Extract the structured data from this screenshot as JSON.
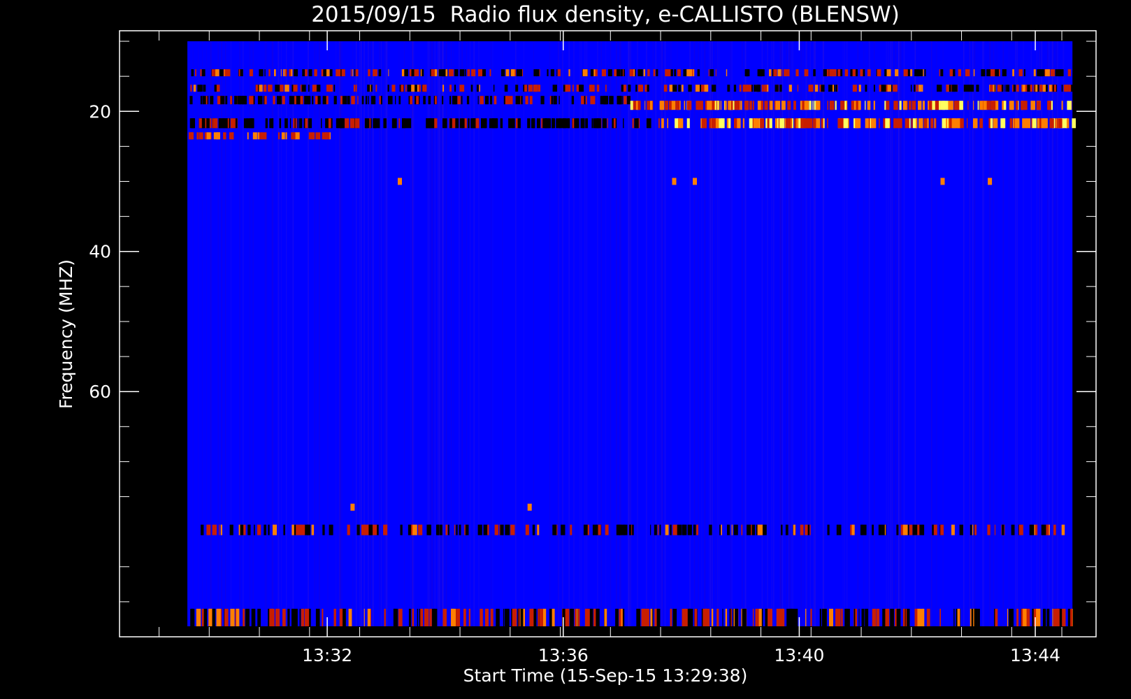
{
  "chart_data": {
    "type": "heatmap",
    "title": "2015/09/15  Radio flux density, e-CALLISTO (BLENSW)",
    "xlabel": "Start Time (15-Sep-15 13:29:38)",
    "ylabel": "Frequency (MHZ)",
    "x_start_time": "13:29:38",
    "x_end_time": "13:44:38",
    "xlim_minutes": [
      -1.15,
      15.4
    ],
    "ylim_mhz": [
      95,
      8.5
    ],
    "x_ticks": [
      {
        "label": "13:32",
        "value": 2.37
      },
      {
        "label": "13:36",
        "value": 6.37
      },
      {
        "label": "13:40",
        "value": 10.37
      },
      {
        "label": "13:44",
        "value": 14.37
      }
    ],
    "y_ticks": [
      {
        "label": "20",
        "value": 20
      },
      {
        "label": "40",
        "value": 40
      },
      {
        "label": "60",
        "value": 60
      }
    ],
    "colormap": [
      "#0000ff",
      "#000000",
      "#c81e00",
      "#ff7f00",
      "#ffff60"
    ],
    "bands": [
      {
        "f1": 14.0,
        "f2": 15.0,
        "t1": 0,
        "t2": 15,
        "kind": "mixed",
        "level": 0.6
      },
      {
        "f1": 16.2,
        "f2": 17.2,
        "t1": 0,
        "t2": 15,
        "kind": "mixed",
        "level": 0.55
      },
      {
        "f1": 17.8,
        "f2": 19.0,
        "t1": 0,
        "t2": 7.5,
        "kind": "dark",
        "level": 0.6
      },
      {
        "f1": 18.5,
        "f2": 19.8,
        "t1": 7.5,
        "t2": 15,
        "kind": "bright",
        "level": 0.75
      },
      {
        "f1": 21.0,
        "f2": 22.4,
        "t1": 0,
        "t2": 8.0,
        "kind": "dark",
        "level": 0.8
      },
      {
        "f1": 21.0,
        "f2": 22.4,
        "t1": 8.0,
        "t2": 15,
        "kind": "bright",
        "level": 0.9
      },
      {
        "f1": 23.0,
        "f2": 24.0,
        "t1": 0,
        "t2": 2.5,
        "kind": "red",
        "level": 0.6
      },
      {
        "f1": 79.0,
        "f2": 80.5,
        "t1": 0,
        "t2": 15,
        "kind": "mixed",
        "level": 0.4
      },
      {
        "f1": 91.0,
        "f2": 93.5,
        "t1": 0,
        "t2": 15,
        "kind": "mixed",
        "level": 0.6
      }
    ],
    "spots": [
      {
        "t": 3.6,
        "f": 30.0
      },
      {
        "t": 8.25,
        "f": 30.0
      },
      {
        "t": 8.6,
        "f": 30.0
      },
      {
        "t": 12.8,
        "f": 30.0
      },
      {
        "t": 13.6,
        "f": 30.0
      },
      {
        "t": 2.8,
        "f": 76.5
      },
      {
        "t": 5.8,
        "f": 76.5
      }
    ]
  }
}
